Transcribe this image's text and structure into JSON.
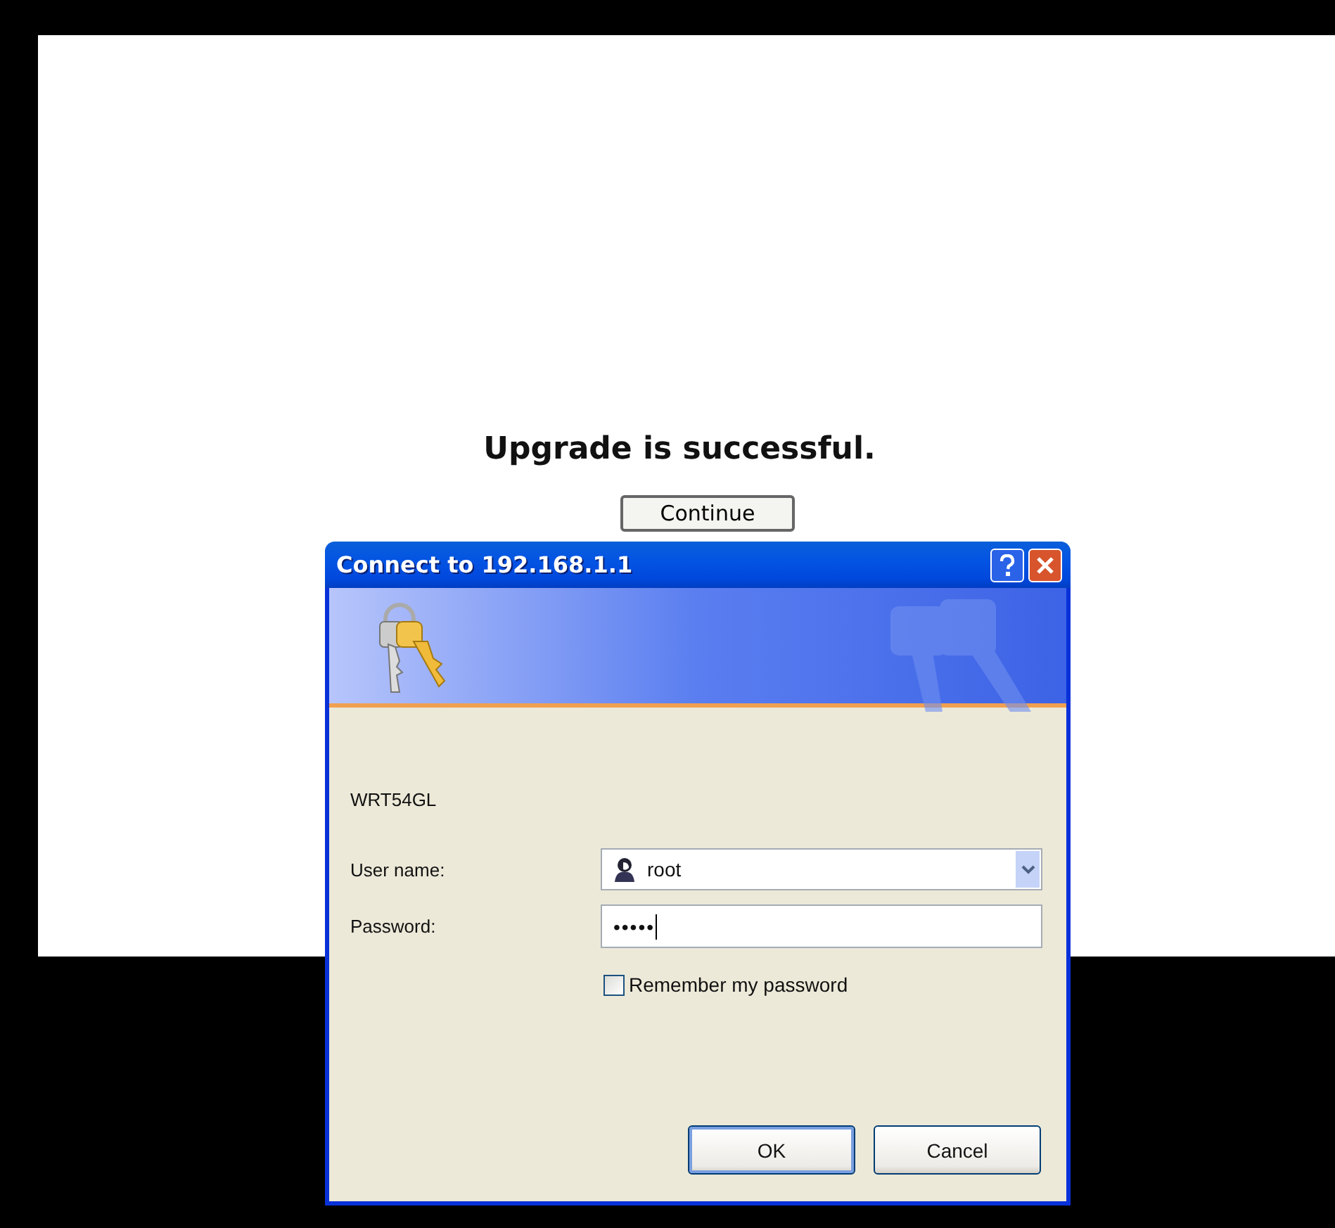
{
  "page": {
    "heading": "Upgrade is successful.",
    "button": "Continue"
  },
  "dialog": {
    "title": "Connect to 192.168.1.1",
    "message": "WRT54GL",
    "fields": [
      {
        "kind": "combo",
        "label": "User name:",
        "value": "root"
      },
      {
        "kind": "password",
        "label": "Password:",
        "value": "•••••"
      }
    ],
    "checkbox": {
      "label": "Remember my password",
      "checked": false
    },
    "buttons": [
      {
        "label": "OK",
        "selected": true
      },
      {
        "label": "Cancel",
        "selected": false
      }
    ]
  }
}
